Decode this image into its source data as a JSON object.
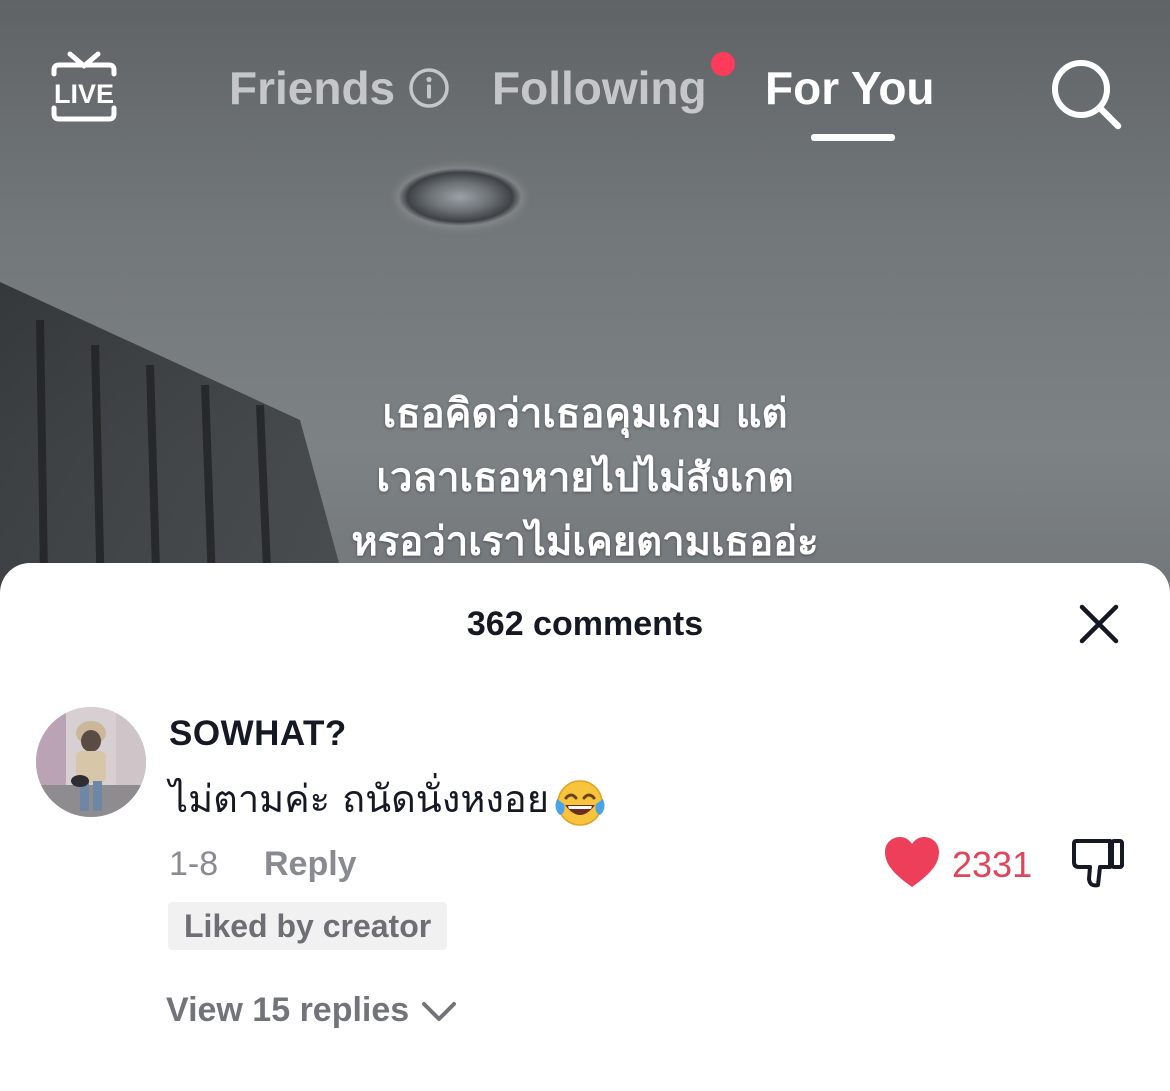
{
  "nav": {
    "live_label": "LIVE",
    "tabs": [
      {
        "label": "Friends",
        "active": false
      },
      {
        "label": "Following",
        "active": false,
        "notification_dot": true
      },
      {
        "label": "For You",
        "active": true
      }
    ]
  },
  "video": {
    "caption_lines": [
      "เธอคิดว่าเธอคุมเกม แต่",
      "เวลาเธอหายไปไม่สังเกต",
      "หรอว่าเราไม่เคยตามเธออ่ะ"
    ]
  },
  "comments_sheet": {
    "title": "362 comments",
    "comment": {
      "username": "SOWHAT?",
      "text": "ไม่ตามค่ะ ถนัดนั่งหงอย",
      "emoji": "face-with-tears-of-joy",
      "date": "1-8",
      "reply_label": "Reply",
      "like_count": "2331",
      "liked_by_creator_label": "Liked by creator",
      "view_replies_label": "View 15 replies"
    }
  },
  "colors": {
    "accent_red": "#ff3b5c",
    "like_red": "#e0455b",
    "text_dark": "#161823",
    "text_gray": "#8a8b91"
  }
}
